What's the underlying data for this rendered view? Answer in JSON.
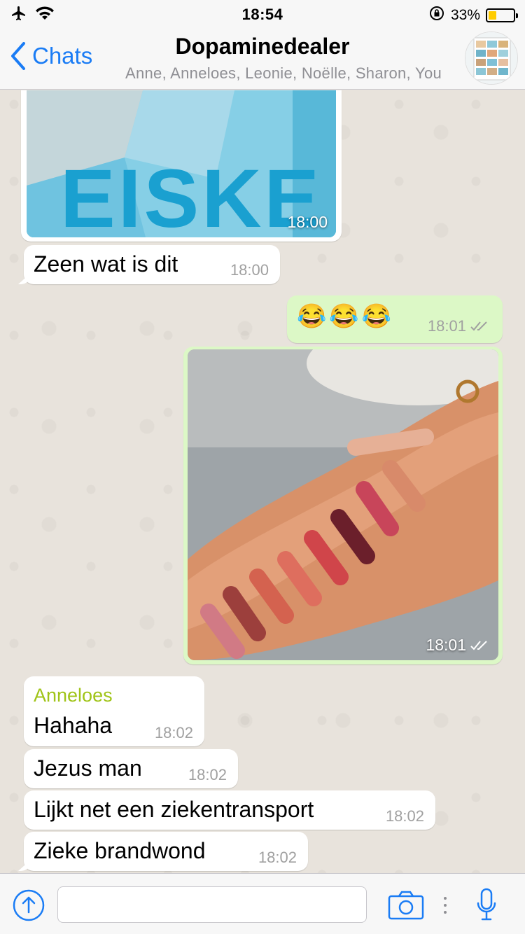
{
  "status_bar": {
    "time": "18:54",
    "battery_percent": "33%",
    "battery_level": 0.33,
    "icons": [
      "airplane-icon",
      "wifi-icon",
      "rotation-lock-icon",
      "battery-icon"
    ]
  },
  "nav": {
    "back_label": "Chats",
    "title": "Dopaminedealer",
    "subtitle": "Anne, Anneloes, Leonie, Noëlle, Sharon, You"
  },
  "messages": [
    {
      "type": "image",
      "direction": "in",
      "caption_word": "EISKE",
      "time": "18:00"
    },
    {
      "type": "text",
      "direction": "in",
      "text": "Zeen wat is dit",
      "time": "18:00"
    },
    {
      "type": "text",
      "direction": "out",
      "text": "😂😂😂",
      "time": "18:01",
      "status": "read"
    },
    {
      "type": "image",
      "direction": "out",
      "time": "18:01",
      "status": "read"
    },
    {
      "type": "text",
      "direction": "in",
      "sender": "Anneloes",
      "text": "Hahaha",
      "time": "18:02"
    },
    {
      "type": "text",
      "direction": "in",
      "text": "Jezus man",
      "time": "18:02"
    },
    {
      "type": "text",
      "direction": "in",
      "text": "Lijkt net een ziekentransport",
      "time": "18:02"
    },
    {
      "type": "text",
      "direction": "in",
      "text": "Zieke brandwond",
      "time": "18:02"
    }
  ],
  "input": {
    "placeholder": "",
    "icons": [
      "share-upload-icon",
      "camera-icon",
      "more-dots-icon",
      "microphone-icon"
    ]
  },
  "colors": {
    "accent": "#1a7cf5",
    "outgoing_bubble": "#dcf8c6",
    "incoming_bubble": "#ffffff",
    "sender_name": "#a0c418",
    "background": "#e8e3dc"
  }
}
